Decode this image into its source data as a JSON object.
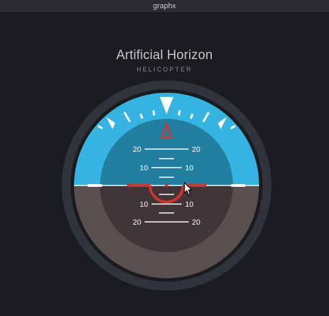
{
  "window": {
    "title": "graphx"
  },
  "header": {
    "title": "Artificial Horizon",
    "subtitle": "HELICOPTER"
  },
  "instrument": {
    "pitch_deg": 0,
    "roll_deg": 0,
    "pitch_labels": {
      "up20_left": "20",
      "up20_right": "20",
      "up10_left": "10",
      "up10_right": "10",
      "down10_left": "10",
      "down10_right": "10",
      "down20_left": "20",
      "down20_right": "20"
    },
    "colors": {
      "sky": "#35b4e2",
      "sky_inner": "#237fa0",
      "ground": "#5a4f4f",
      "ground_inner": "#413537",
      "bezel": "#2f333b",
      "indicator": "#d0342c",
      "ticks": "#ffffff"
    }
  },
  "cursor": {
    "icon": "arrow-pointer-icon"
  }
}
